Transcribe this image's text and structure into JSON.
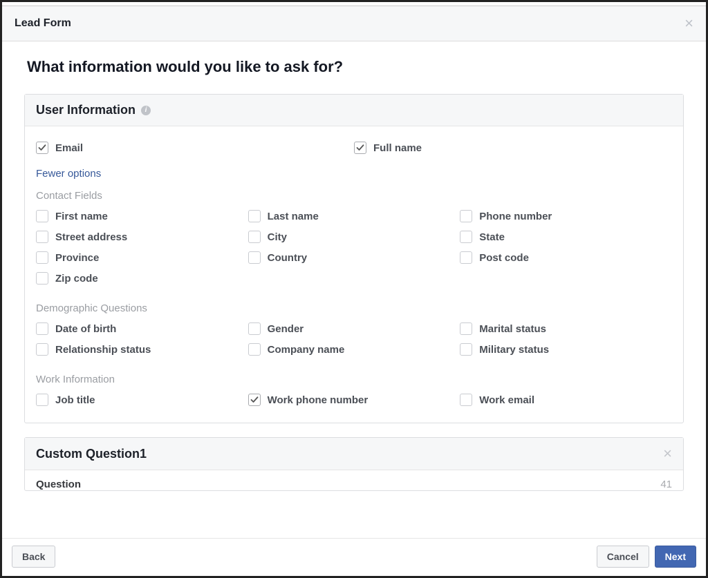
{
  "modal": {
    "title": "Lead Form"
  },
  "page": {
    "heading": "What information would you like to ask for?"
  },
  "userInfo": {
    "title": "User Information",
    "fewerOptions": "Fewer options",
    "primary": {
      "email": {
        "label": "Email",
        "checked": true
      },
      "fullName": {
        "label": "Full name",
        "checked": true
      }
    },
    "contactFields": {
      "label": "Contact Fields",
      "items": {
        "firstName": {
          "label": "First name",
          "checked": false
        },
        "lastName": {
          "label": "Last name",
          "checked": false
        },
        "phoneNumber": {
          "label": "Phone number",
          "checked": false
        },
        "streetAddress": {
          "label": "Street address",
          "checked": false
        },
        "city": {
          "label": "City",
          "checked": false
        },
        "state": {
          "label": "State",
          "checked": false
        },
        "province": {
          "label": "Province",
          "checked": false
        },
        "country": {
          "label": "Country",
          "checked": false
        },
        "postCode": {
          "label": "Post code",
          "checked": false
        },
        "zipCode": {
          "label": "Zip code",
          "checked": false
        }
      }
    },
    "demographic": {
      "label": "Demographic Questions",
      "items": {
        "dateOfBirth": {
          "label": "Date of birth",
          "checked": false
        },
        "gender": {
          "label": "Gender",
          "checked": false
        },
        "maritalStatus": {
          "label": "Marital status",
          "checked": false
        },
        "relationshipStatus": {
          "label": "Relationship status",
          "checked": false
        },
        "companyName": {
          "label": "Company name",
          "checked": false
        },
        "militaryStatus": {
          "label": "Military status",
          "checked": false
        }
      }
    },
    "workInfo": {
      "label": "Work Information",
      "items": {
        "jobTitle": {
          "label": "Job title",
          "checked": false
        },
        "workPhoneNumber": {
          "label": "Work phone number",
          "checked": true
        },
        "workEmail": {
          "label": "Work email",
          "checked": false
        }
      }
    }
  },
  "customQuestion": {
    "title": "Custom Question1",
    "fieldLabel": "Question",
    "charCount": "41"
  },
  "footer": {
    "back": "Back",
    "cancel": "Cancel",
    "next": "Next"
  }
}
